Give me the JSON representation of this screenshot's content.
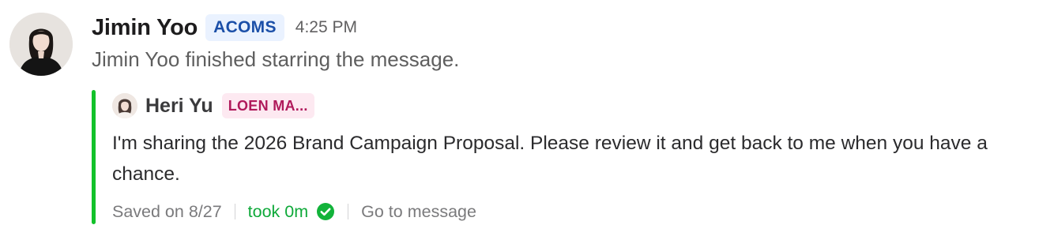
{
  "message": {
    "sender": "Jimin Yoo",
    "org_badge": "ACOMS",
    "time": "4:25 PM",
    "system_text": "Jimin Yoo finished starring the message.",
    "avatar_icon": "user-avatar-photo"
  },
  "quote": {
    "author": "Heri Yu",
    "badge": "LOEN MA...",
    "body": "I'm sharing the 2026 Brand Campaign Proposal. Please review it and get back to me when you have a chance.",
    "accent_color": "#12c22a",
    "footer": {
      "saved": "Saved on 8/27",
      "took": "took 0m",
      "status_icon": "check-circle-icon",
      "goto": "Go to message"
    }
  }
}
